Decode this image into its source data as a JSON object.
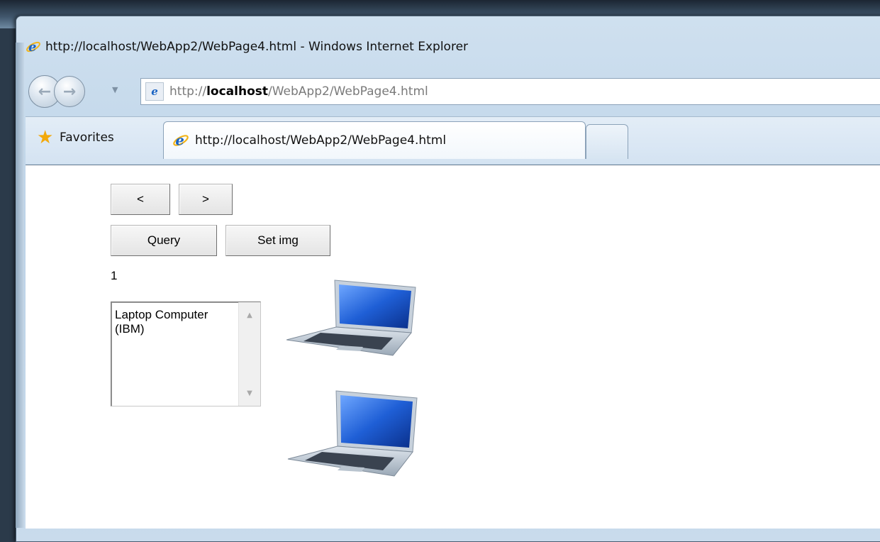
{
  "window": {
    "title": "http://localhost/WebApp2/WebPage4.html - Windows Internet Explorer"
  },
  "addressbar": {
    "prefix": "http://",
    "host": "localhost",
    "path": "/WebApp2/WebPage4.html"
  },
  "tabs": {
    "favorites_label": "Favorites",
    "active_tab_label": "http://localhost/WebApp2/WebPage4.html"
  },
  "page": {
    "prev_label": "<",
    "next_label": ">",
    "query_label": "Query",
    "setimg_label": "Set img",
    "counter": "1",
    "listbox_value": "Laptop Computer (IBM)"
  },
  "icons": {
    "browser": "ie-icon",
    "favorites": "star-icon",
    "page": "page-icon",
    "product_image": "laptop-icon"
  },
  "colors": {
    "chrome_blue": "#cfe0ef",
    "ie_logo": "#1a63c3",
    "laptop_screen": "#1f5fd6"
  }
}
